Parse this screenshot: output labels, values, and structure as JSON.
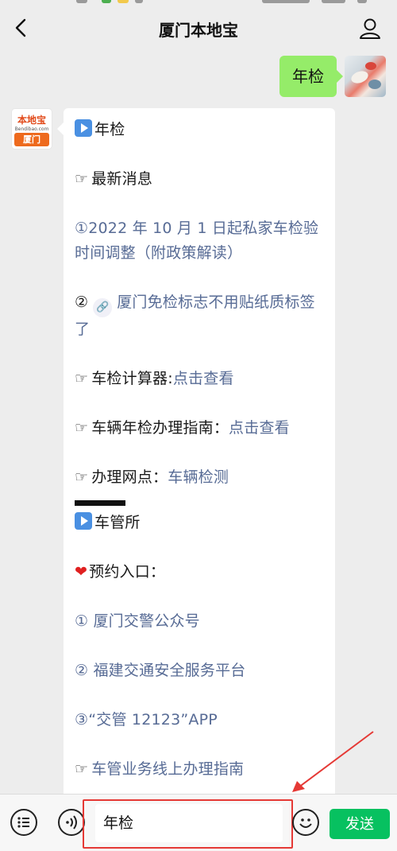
{
  "header": {
    "title": "厦门本地宝"
  },
  "conversation": {
    "user_message": "年检",
    "bot": {
      "logo_top": "本地宝",
      "logo_sub": "Bendibao.com",
      "logo_city": "厦门",
      "lines": {
        "heading1": "年检",
        "latest_news": "最新消息",
        "news1": "①2022 年 10 月 1 日起私家车检验时间调整（附政策解读）",
        "news2_num": "②",
        "news2": "厦门免检标志不用贴纸质标签了",
        "calculator_label": "车检计算器:",
        "calculator_link": "点击查看",
        "guide_label": "车辆年检办理指南：",
        "guide_link": "点击查看",
        "outlets_label": "办理网点：",
        "outlets_link": "车辆检测",
        "heading2": "车管所",
        "booking_label": "预约入口：",
        "booking1": "① 厦门交警公众号",
        "booking2": "② 福建交通安全服务平台",
        "booking3": "③“交管 12123”APP",
        "online_guide": "车管业务线上办理指南"
      }
    }
  },
  "input_bar": {
    "value": "年检",
    "send_label": "发送"
  },
  "colors": {
    "bubble_user": "#95ec69",
    "link": "#576b95",
    "send": "#07c160",
    "annotation": "#e53935"
  }
}
